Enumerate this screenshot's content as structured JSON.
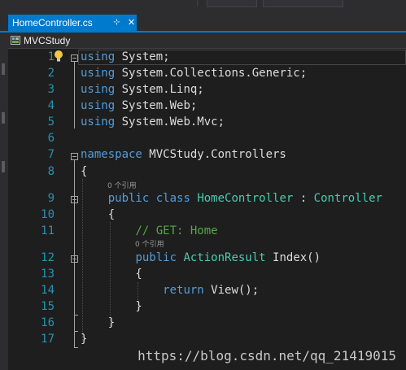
{
  "tab": {
    "label": "HomeController.cs",
    "pin_glyph": "⊹",
    "close_glyph": "✕"
  },
  "navbar": {
    "project": "MVCStudy"
  },
  "lines": [
    {
      "n": "1",
      "segs": [
        [
          "kw-dim",
          "using"
        ],
        [
          "plain",
          " System;"
        ]
      ]
    },
    {
      "n": "2",
      "segs": [
        [
          "kw-dim",
          "using"
        ],
        [
          "plain",
          " System.Collections.Generic;"
        ]
      ]
    },
    {
      "n": "3",
      "segs": [
        [
          "kw-dim",
          "using"
        ],
        [
          "plain",
          " System.Linq;"
        ]
      ]
    },
    {
      "n": "4",
      "segs": [
        [
          "kw-dim",
          "using"
        ],
        [
          "plain",
          " System.Web;"
        ]
      ]
    },
    {
      "n": "5",
      "segs": [
        [
          "kw-dim",
          "using"
        ],
        [
          "plain",
          " System.Web.Mvc;"
        ]
      ]
    },
    {
      "n": "6",
      "segs": []
    },
    {
      "n": "7",
      "segs": [
        [
          "kw",
          "namespace"
        ],
        [
          "plain",
          " MVCStudy.Controllers"
        ]
      ]
    },
    {
      "n": "8",
      "segs": [
        [
          "plain",
          "{"
        ]
      ]
    },
    {
      "n": "9",
      "segs": [
        [
          "plain",
          "    "
        ],
        [
          "kw",
          "public"
        ],
        [
          "plain",
          " "
        ],
        [
          "kw",
          "class"
        ],
        [
          "plain",
          " "
        ],
        [
          "ty",
          "HomeController"
        ],
        [
          "plain",
          " : "
        ],
        [
          "ty",
          "Controller"
        ]
      ]
    },
    {
      "n": "10",
      "segs": [
        [
          "plain",
          "    {"
        ]
      ]
    },
    {
      "n": "11",
      "segs": [
        [
          "plain",
          "        "
        ],
        [
          "cm",
          "// GET: Home"
        ]
      ]
    },
    {
      "n": "12",
      "segs": [
        [
          "plain",
          "        "
        ],
        [
          "kw",
          "public"
        ],
        [
          "plain",
          " "
        ],
        [
          "ty",
          "ActionResult"
        ],
        [
          "plain",
          " Index()"
        ]
      ]
    },
    {
      "n": "13",
      "segs": [
        [
          "plain",
          "        {"
        ]
      ]
    },
    {
      "n": "14",
      "segs": [
        [
          "plain",
          "            "
        ],
        [
          "kw",
          "return"
        ],
        [
          "plain",
          " View();"
        ]
      ]
    },
    {
      "n": "15",
      "segs": [
        [
          "plain",
          "        }"
        ]
      ]
    },
    {
      "n": "16",
      "segs": [
        [
          "plain",
          "    }"
        ]
      ]
    },
    {
      "n": "17",
      "segs": [
        [
          "plain",
          "}"
        ]
      ]
    }
  ],
  "codelens": {
    "class_refs": "0 个引用",
    "method_refs": "0 个引用"
  },
  "watermark": "https://blog.csdn.net/qq_21419015",
  "colors": {
    "keyword": "#569cd6",
    "type": "#4ec9b0",
    "comment": "#57a64a",
    "line_number": "#2b91af",
    "accent": "#007acc"
  }
}
